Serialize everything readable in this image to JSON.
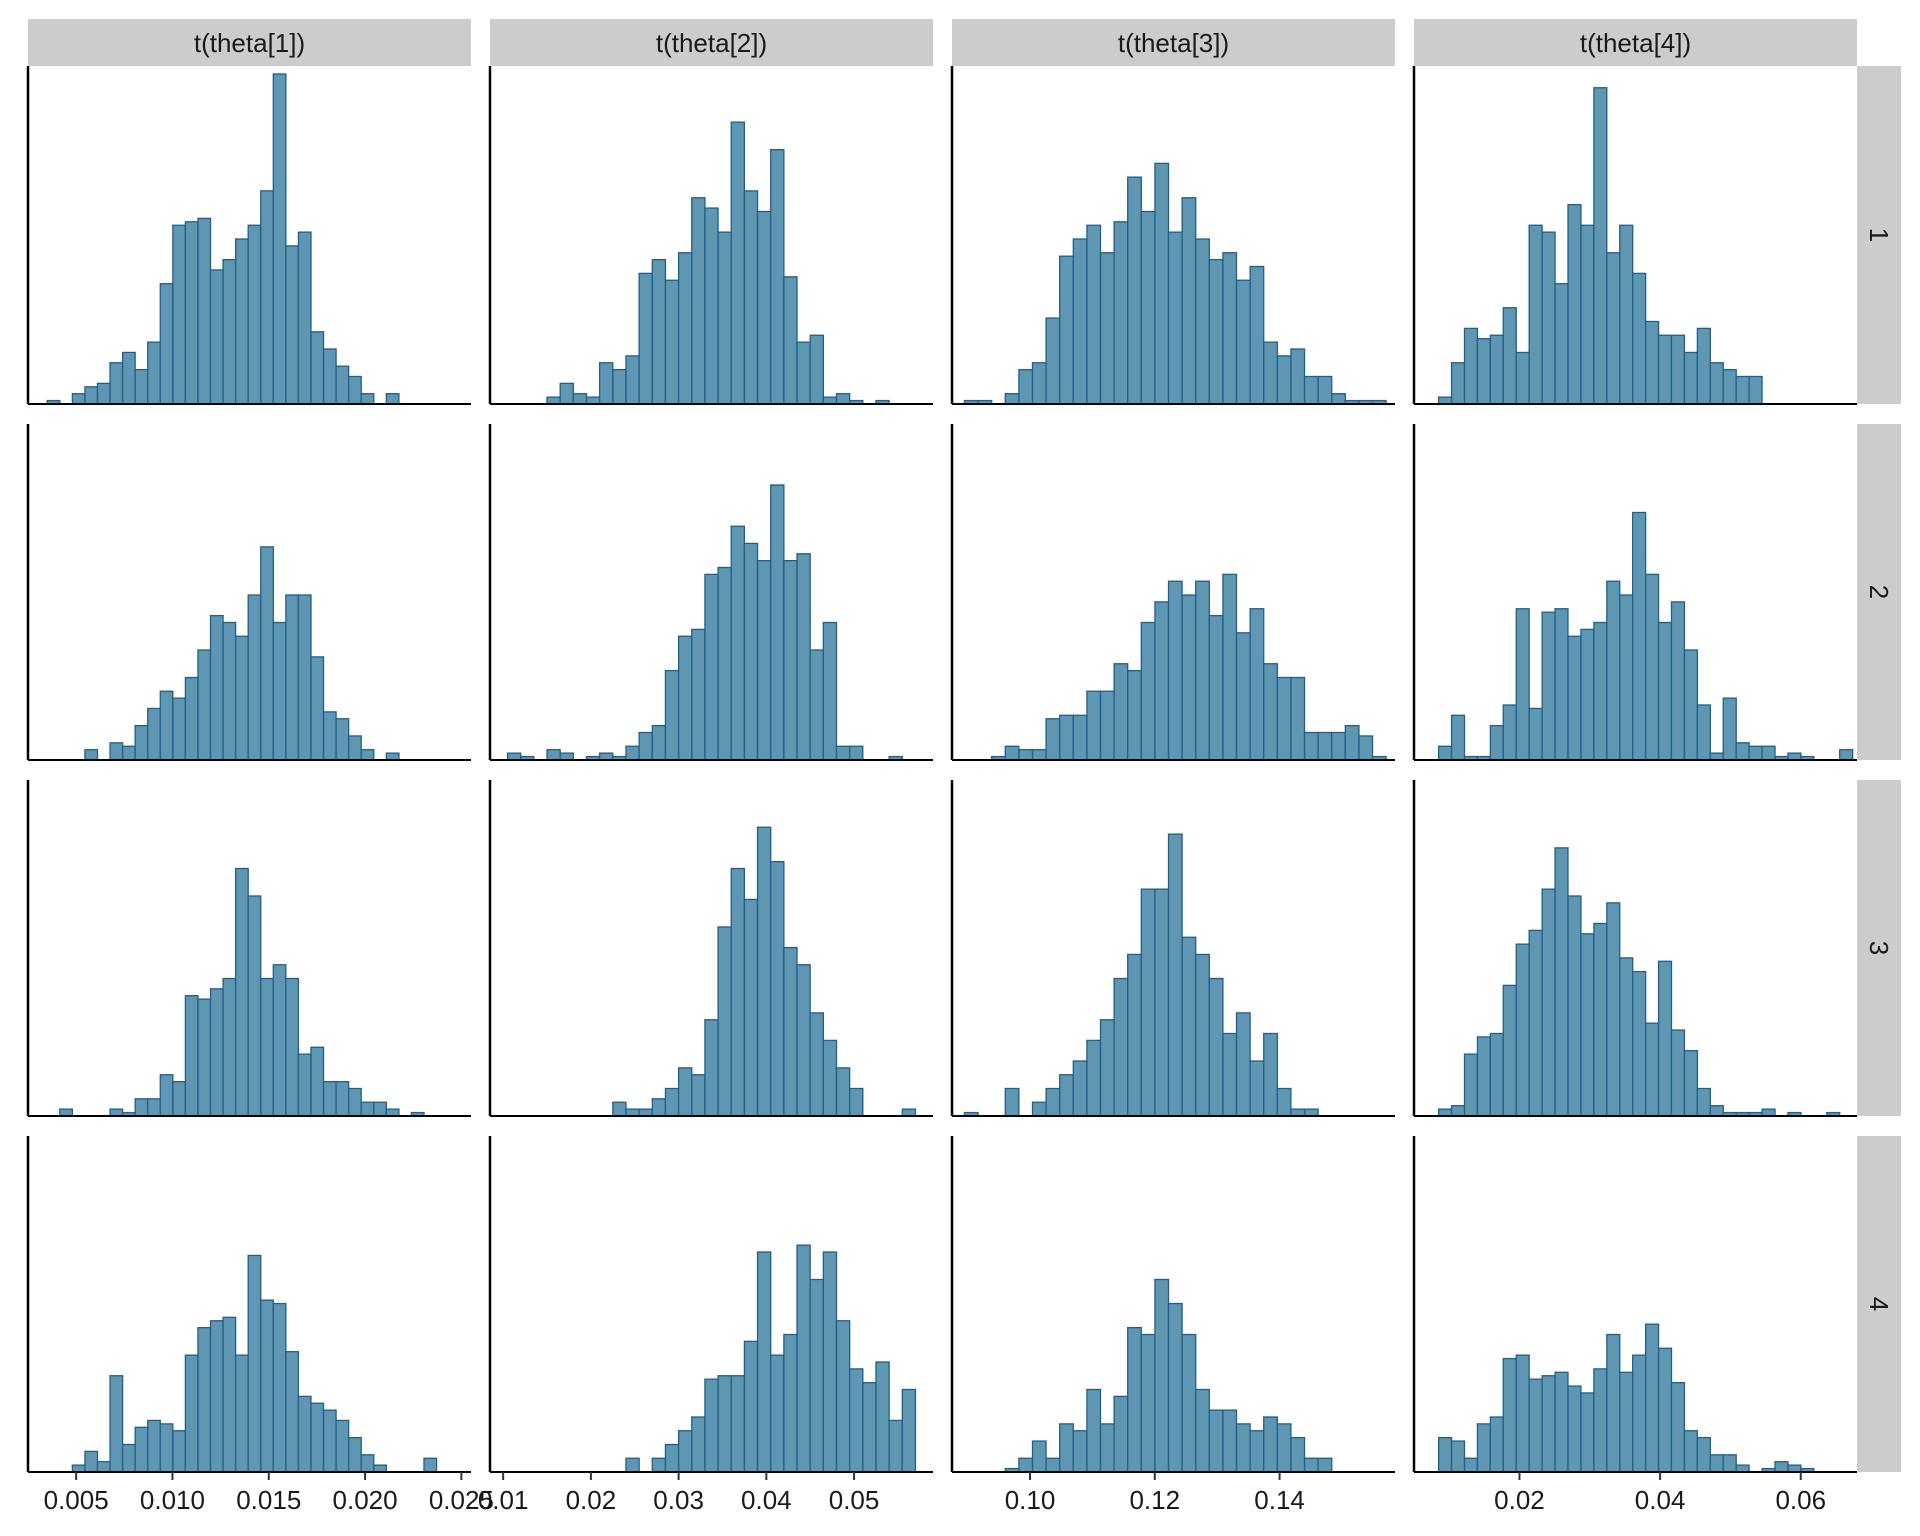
{
  "chart_data": {
    "type": "histogram-facet-grid",
    "bar_fill": "#5f97b2",
    "bar_stroke": "#1f5f8b",
    "strip_fill": "#cccccc",
    "col_labels": [
      "t(theta[1])",
      "t(theta[2])",
      "t(theta[3])",
      "t(theta[4])"
    ],
    "row_labels": [
      "1",
      "2",
      "3",
      "4"
    ],
    "x_axes": [
      {
        "xlim": [
          0.0025,
          0.0255
        ],
        "ticks": [
          0.005,
          0.01,
          0.015,
          0.02,
          0.025
        ],
        "tick_labels": [
          "0.005",
          "0.010",
          "0.015",
          "0.020",
          "0.025"
        ]
      },
      {
        "xlim": [
          0.0085,
          0.059
        ],
        "ticks": [
          0.01,
          0.02,
          0.03,
          0.04,
          0.05
        ],
        "tick_labels": [
          "0.01",
          "0.02",
          "0.03",
          "0.04",
          "0.05"
        ]
      },
      {
        "xlim": [
          0.0875,
          0.1585
        ],
        "ticks": [
          0.1,
          0.12,
          0.14
        ],
        "tick_labels": [
          "0.10",
          "0.12",
          "0.14"
        ]
      },
      {
        "xlim": [
          0.005,
          0.068
        ],
        "ticks": [
          0.02,
          0.04,
          0.06
        ],
        "tick_labels": [
          "0.02",
          "0.04",
          "0.06"
        ]
      }
    ],
    "panels": [
      [
        {
          "x_start": 0.0035,
          "bin_width": 0.000652,
          "counts": [
            1,
            0,
            3,
            5,
            6,
            12,
            15,
            10,
            18,
            35,
            52,
            53,
            54,
            39,
            42,
            48,
            52,
            62,
            96,
            46,
            50,
            21,
            16,
            11,
            8,
            3,
            0,
            3,
            0,
            0,
            0
          ]
        },
        {
          "x_start": 0.0105,
          "bin_width": 0.0015,
          "counts": [
            0,
            0,
            0,
            2,
            6,
            3,
            2,
            12,
            10,
            14,
            38,
            42,
            36,
            44,
            60,
            57,
            50,
            82,
            62,
            56,
            74,
            37,
            18,
            20,
            2,
            3,
            1,
            0,
            1,
            0
          ]
        },
        {
          "x_start": 0.0895,
          "bin_width": 0.00218,
          "counts": [
            1,
            1,
            0,
            3,
            10,
            12,
            25,
            43,
            48,
            52,
            44,
            53,
            66,
            56,
            70,
            50,
            60,
            48,
            42,
            44,
            36,
            40,
            18,
            14,
            16,
            8,
            8,
            3,
            1,
            1,
            1
          ]
        },
        {
          "x_start": 0.0085,
          "bin_width": 0.00184,
          "counts": [
            2,
            12,
            22,
            19,
            20,
            28,
            15,
            52,
            50,
            35,
            58,
            52,
            92,
            44,
            52,
            38,
            24,
            20,
            20,
            15,
            22,
            12,
            10,
            8,
            8,
            0,
            0,
            0,
            0,
            0
          ]
        }
      ],
      [
        {
          "x_start": 0.0035,
          "bin_width": 0.000652,
          "counts": [
            0,
            0,
            0,
            3,
            0,
            5,
            4,
            10,
            15,
            20,
            18,
            24,
            32,
            42,
            40,
            36,
            48,
            62,
            40,
            48,
            48,
            30,
            14,
            12,
            7,
            3,
            0,
            2,
            0,
            0
          ]
        },
        {
          "x_start": 0.0105,
          "bin_width": 0.0015,
          "counts": [
            2,
            1,
            0,
            3,
            2,
            0,
            1,
            2,
            1,
            4,
            8,
            10,
            26,
            36,
            38,
            54,
            56,
            68,
            63,
            58,
            80,
            58,
            60,
            32,
            40,
            4,
            4,
            0,
            0,
            1
          ]
        },
        {
          "x_start": 0.0895,
          "bin_width": 0.00218,
          "counts": [
            0,
            0,
            1,
            4,
            3,
            3,
            12,
            13,
            13,
            20,
            20,
            28,
            26,
            40,
            46,
            52,
            48,
            52,
            42,
            54,
            37,
            44,
            28,
            24,
            24,
            8,
            8,
            8,
            10,
            7,
            1
          ]
        },
        {
          "x_start": 0.0085,
          "bin_width": 0.00184,
          "counts": [
            4,
            13,
            1,
            1,
            10,
            16,
            44,
            15,
            43,
            44,
            36,
            38,
            40,
            52,
            48,
            72,
            54,
            40,
            46,
            32,
            16,
            2,
            18,
            5,
            4,
            4,
            1,
            2,
            1,
            0,
            0,
            3,
            0
          ]
        }
      ],
      [
        {
          "x_start": 0.0035,
          "bin_width": 0.000652,
          "counts": [
            0,
            2,
            0,
            0,
            0,
            2,
            1,
            5,
            5,
            12,
            10,
            35,
            34,
            37,
            40,
            72,
            64,
            40,
            44,
            40,
            18,
            20,
            10,
            10,
            8,
            4,
            4,
            2,
            0,
            1,
            0
          ]
        },
        {
          "x_start": 0.0105,
          "bin_width": 0.0015,
          "counts": [
            0,
            0,
            0,
            0,
            0,
            0,
            0,
            0,
            4,
            2,
            2,
            5,
            8,
            14,
            12,
            28,
            55,
            72,
            63,
            84,
            74,
            49,
            44,
            30,
            22,
            14,
            8,
            0,
            0,
            0,
            2
          ]
        },
        {
          "x_start": 0.0895,
          "bin_width": 0.00218,
          "counts": [
            1,
            0,
            0,
            8,
            0,
            4,
            8,
            12,
            16,
            22,
            28,
            40,
            47,
            66,
            66,
            82,
            52,
            47,
            40,
            24,
            30,
            16,
            24,
            8,
            2,
            2,
            0
          ]
        },
        {
          "x_start": 0.0085,
          "bin_width": 0.00184,
          "counts": [
            2,
            3,
            18,
            23,
            24,
            38,
            50,
            54,
            66,
            78,
            64,
            53,
            56,
            62,
            46,
            42,
            27,
            45,
            25,
            19,
            8,
            3,
            1,
            1,
            1,
            2,
            0,
            1,
            0,
            0,
            1
          ]
        }
      ],
      [
        {
          "x_start": 0.0035,
          "bin_width": 0.000652,
          "counts": [
            0,
            0,
            2,
            6,
            3,
            28,
            8,
            13,
            15,
            14,
            12,
            34,
            42,
            44,
            45,
            34,
            63,
            50,
            49,
            35,
            22,
            20,
            18,
            15,
            10,
            5,
            2,
            0,
            0,
            0,
            4
          ]
        },
        {
          "x_start": 0.0105,
          "bin_width": 0.0015,
          "counts": [
            0,
            0,
            0,
            0,
            0,
            0,
            0,
            0,
            0,
            4,
            0,
            4,
            8,
            12,
            16,
            27,
            28,
            28,
            38,
            64,
            34,
            40,
            66,
            56,
            64,
            44,
            30,
            26,
            32,
            15,
            24,
            0,
            0,
            0,
            0,
            0,
            0,
            0
          ]
        },
        {
          "x_start": 0.0895,
          "bin_width": 0.00218,
          "counts": [
            0,
            0,
            0,
            1,
            4,
            9,
            4,
            14,
            12,
            24,
            14,
            22,
            42,
            40,
            56,
            49,
            40,
            24,
            18,
            18,
            14,
            12,
            16,
            14,
            10,
            4,
            4,
            0,
            0,
            0
          ]
        },
        {
          "x_start": 0.0085,
          "bin_width": 0.00184,
          "counts": [
            10,
            9,
            4,
            14,
            16,
            33,
            34,
            27,
            28,
            29,
            25,
            23,
            30,
            40,
            29,
            34,
            43,
            36,
            26,
            12,
            10,
            5,
            5,
            2,
            0,
            1,
            3,
            2,
            1,
            0
          ]
        }
      ]
    ]
  }
}
